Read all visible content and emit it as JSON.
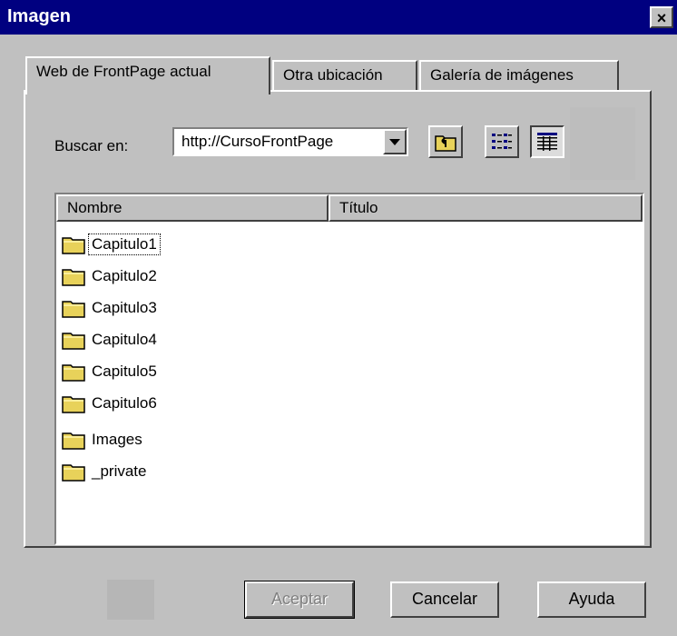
{
  "window": {
    "title": "Imagen",
    "close_label": "×"
  },
  "tabs": [
    {
      "label": "Web de FrontPage actual",
      "active": true
    },
    {
      "label": "Otra ubicación",
      "active": false
    },
    {
      "label": "Galería de imágenes",
      "active": false
    }
  ],
  "search": {
    "label": "Buscar en:",
    "value": "http://CursoFrontPage"
  },
  "toolbar": {
    "up_icon": "up-folder-icon",
    "list_icon": "list-view-icon",
    "details_icon": "details-view-icon"
  },
  "list": {
    "columns": [
      "Nombre",
      "Título"
    ],
    "items": [
      {
        "name": "Capitulo1",
        "title": ""
      },
      {
        "name": "Capitulo2",
        "title": ""
      },
      {
        "name": "Capitulo3",
        "title": ""
      },
      {
        "name": "Capitulo4",
        "title": ""
      },
      {
        "name": "Capitulo5",
        "title": ""
      },
      {
        "name": "Capitulo6",
        "title": ""
      },
      {
        "name": "Images",
        "title": ""
      },
      {
        "name": "_private",
        "title": ""
      }
    ]
  },
  "buttons": {
    "ok": "Aceptar",
    "cancel": "Cancelar",
    "help": "Ayuda"
  },
  "colors": {
    "titlebar": "#000080",
    "face": "#c0c0c0",
    "folder": "#e8d25a"
  }
}
